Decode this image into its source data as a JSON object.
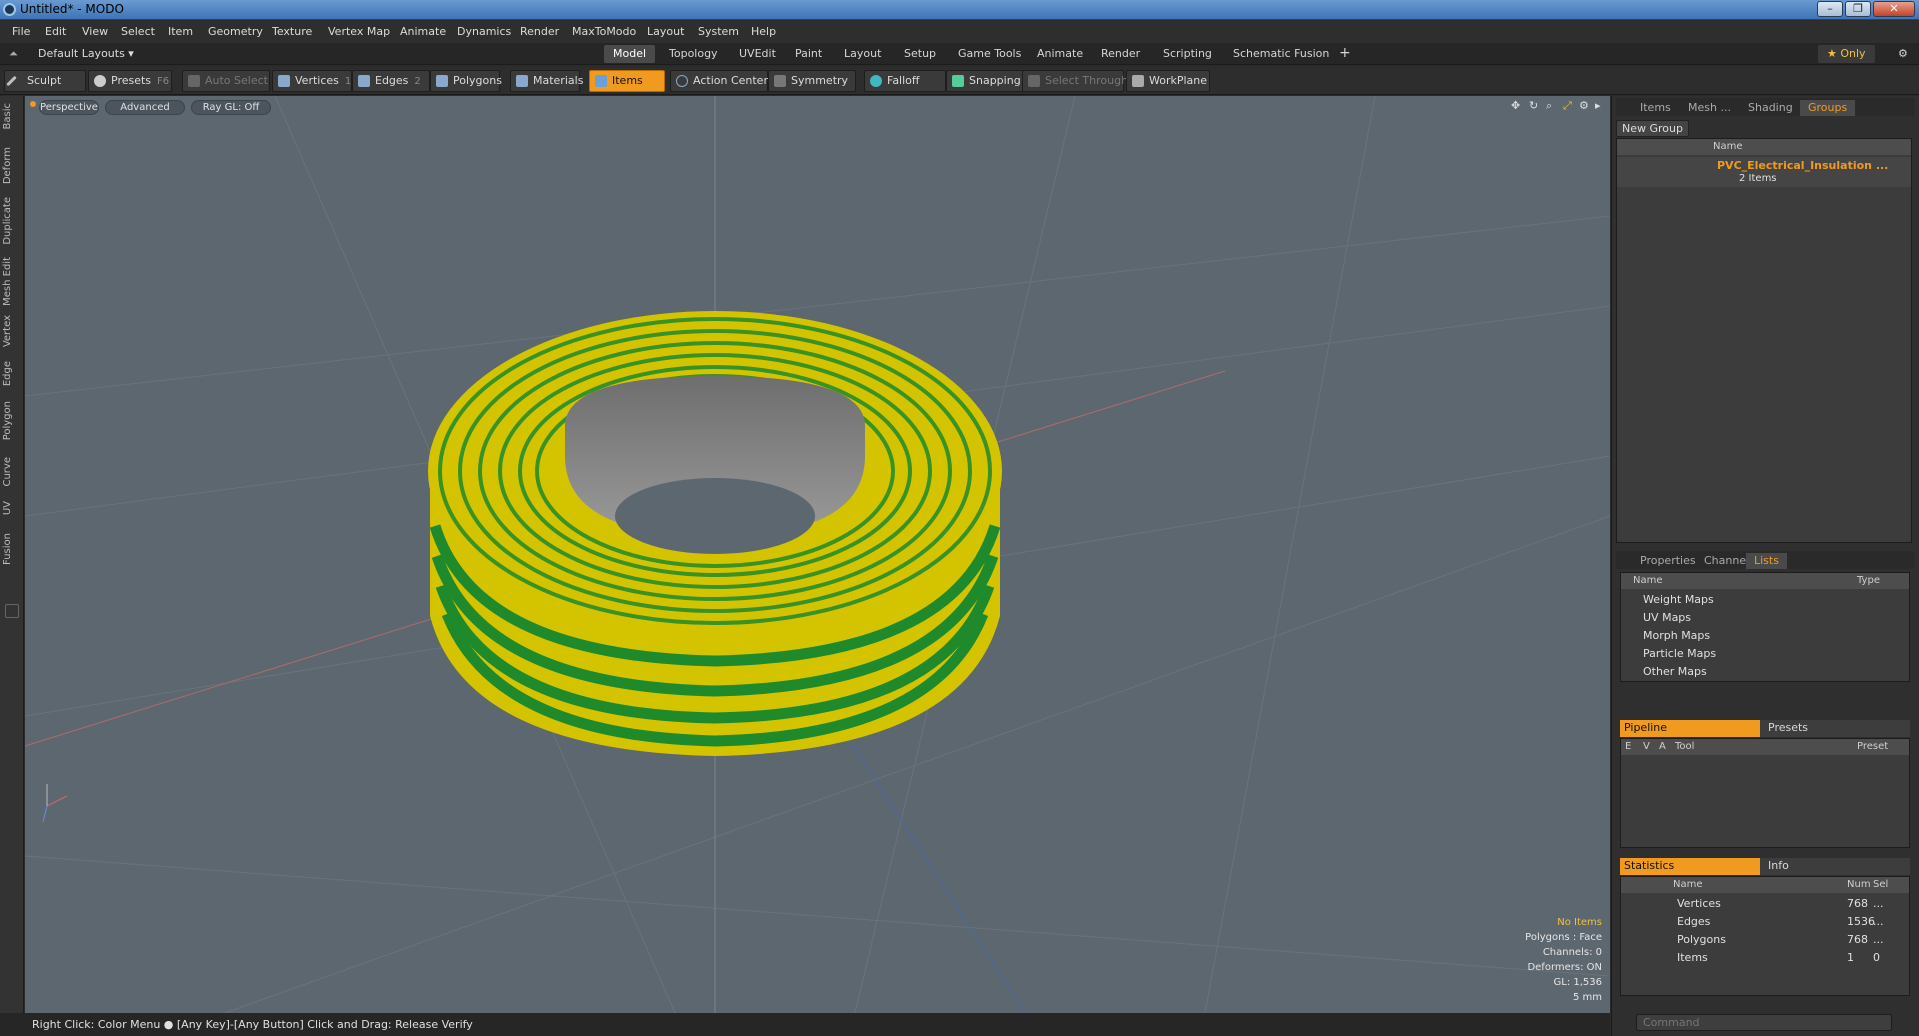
{
  "window": {
    "title": "Untitled* - MODO",
    "controls": [
      "–",
      "❐",
      "✕"
    ]
  },
  "menu": [
    "File",
    "Edit",
    "View",
    "Select",
    "Item",
    "Geometry",
    "Texture",
    "Vertex Map",
    "Animate",
    "Dynamics",
    "Render",
    "MaxToModo",
    "Layout",
    "System",
    "Help"
  ],
  "layouts": {
    "label": "Default Layouts ▾",
    "tabs": [
      "Model",
      "Topology",
      "UVEdit",
      "Paint",
      "Layout",
      "Setup",
      "Game Tools",
      "Animate",
      "Render",
      "Scripting",
      "Schematic Fusion"
    ],
    "add": "+",
    "only": "★ Only",
    "gear": "⚙"
  },
  "toolbar": {
    "sculpt": "Sculpt",
    "presets": "Presets",
    "presets_key": "F6",
    "auto_select": "Auto Select",
    "vertices": "Vertices",
    "vertices_key": "1",
    "edges": "Edges",
    "edges_key": "2",
    "polygons": "Polygons",
    "materials": "Materials",
    "items": "Items",
    "action_center": "Action Center",
    "symmetry": "Symmetry",
    "falloff": "Falloff",
    "snapping": "Snapping",
    "select_through": "Select Through",
    "workplane": "WorkPlane"
  },
  "left_tabs": [
    "Basic",
    "Deform",
    "Duplicate",
    "Mesh Edit",
    "Vertex",
    "Edge",
    "Polygon",
    "Curve",
    "UV",
    "Fusion"
  ],
  "viewport": {
    "perspective": "Perspective",
    "advanced": "Advanced",
    "raygl": "Ray GL: Off",
    "info": {
      "no_items": "No Items",
      "polygons": "Polygons : Face",
      "channels": "Channels: 0",
      "deformers": "Deformers: ON",
      "gl": "GL: 1,536",
      "scale": "5 mm"
    }
  },
  "status": "Right Click: Color Menu ● [Any Key]-[Any Button] Click and Drag: Release Verify",
  "groups_panel": {
    "tabs": [
      "Items",
      "Mesh ...",
      "Shading",
      "Groups"
    ],
    "active": "Groups",
    "new_group": "New Group",
    "name_col": "Name",
    "group_name": "PVC_Electrical_Insulation ...",
    "group_count": "2 Items"
  },
  "lists_panel": {
    "tabs": [
      "Properties",
      "Channels",
      "Lists"
    ],
    "active": "Lists",
    "name_col": "Name",
    "type_col": "Type",
    "items": [
      "Weight Maps",
      "UV Maps",
      "Morph Maps",
      "Particle Maps",
      "Other Maps"
    ]
  },
  "pipeline": {
    "tab": "Pipeline",
    "tab2": "Presets",
    "cols": [
      "E",
      "V",
      "A",
      "Tool",
      "Preset"
    ]
  },
  "statistics": {
    "tab": "Statistics",
    "tab2": "Info",
    "cols": {
      "name": "Name",
      "num": "Num",
      "sel": "Sel"
    },
    "rows": [
      {
        "name": "Vertices",
        "num": "768",
        "sel": "..."
      },
      {
        "name": "Edges",
        "num": "1536",
        "sel": "..."
      },
      {
        "name": "Polygons",
        "num": "768",
        "sel": "..."
      },
      {
        "name": "Items",
        "num": "1",
        "sel": "0"
      }
    ]
  },
  "command_placeholder": "Command",
  "colors": {
    "accent": "#f09a20",
    "viewport": "#5d6770",
    "tape_yellow": "#d4c400",
    "tape_green": "#1f8a2c"
  }
}
